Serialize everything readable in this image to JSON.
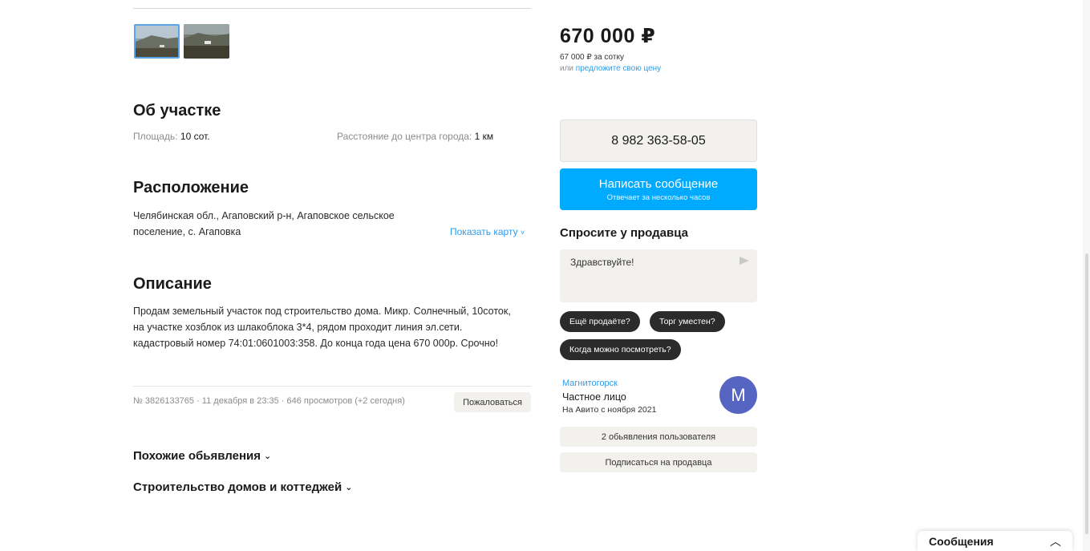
{
  "about": {
    "title": "Об участке",
    "area_label": "Площадь:",
    "area_value": "10 сот.",
    "distance_label": "Расстояние до центра города:",
    "distance_value": "1 км"
  },
  "location": {
    "title": "Расположение",
    "address_line1": "Челябинская обл., Агаповский р-н, Агаповское сельское",
    "address_line2": "поселение, с. Агаповка",
    "show_map": "Показать карту",
    "show_map_icon": "chevron-down-icon"
  },
  "description": {
    "title": "Описание",
    "line1": "Продам земельный участок под строительство дома. Микр. Солнечный, 10соток,",
    "line2": "на участке хозблок из шлакоблока 3*4, рядом проходит линия эл.сети.",
    "line3": "кадастровый номер 74:01:0601003:358. До конца года цена 670 000р. Срочно!"
  },
  "meta": {
    "text": "№ 3826133765 · 11 декабря в 23:35 · 646 просмотров (+2 сегодня)",
    "complain": "Пожаловаться"
  },
  "sections": {
    "similar": "Похожие обьявления",
    "construction": "Строительство домов и коттеджей",
    "chevron_icon": "chevron-down-icon"
  },
  "pricing": {
    "price": "670 000 ₽",
    "per_unit": "67 000 ₽ за сотку",
    "offer_prefix": "или",
    "offer_link": "предложите свою цену"
  },
  "contact": {
    "phone": "8 982 363-58-05",
    "message_button": "Написать сообщение",
    "message_sub": "Отвечает за несколько часов"
  },
  "ask": {
    "title": "Спросите у продавца",
    "input_value": "Здравствуйте!",
    "send_icon": "send-icon",
    "chips": [
      "Ещё продаёте?",
      "Торг уместен?",
      "Когда можно посмотреть?"
    ]
  },
  "seller": {
    "city": "Магнитогорск",
    "type": "Частное лицо",
    "since": "На Авито с ноября 2021",
    "avatar_letter": "M",
    "listings_button": "2 обьявления пользователя",
    "subscribe_button": "Подписаться на продавца"
  },
  "messages_bar": {
    "label": "Сообщения",
    "icon": "chevron-up-icon"
  },
  "colors": {
    "accent": "#00aaff",
    "link": "#2f9be8",
    "avatar": "#5665c2",
    "chip": "#2b2b2b",
    "button_gray": "#f2f1ee"
  }
}
